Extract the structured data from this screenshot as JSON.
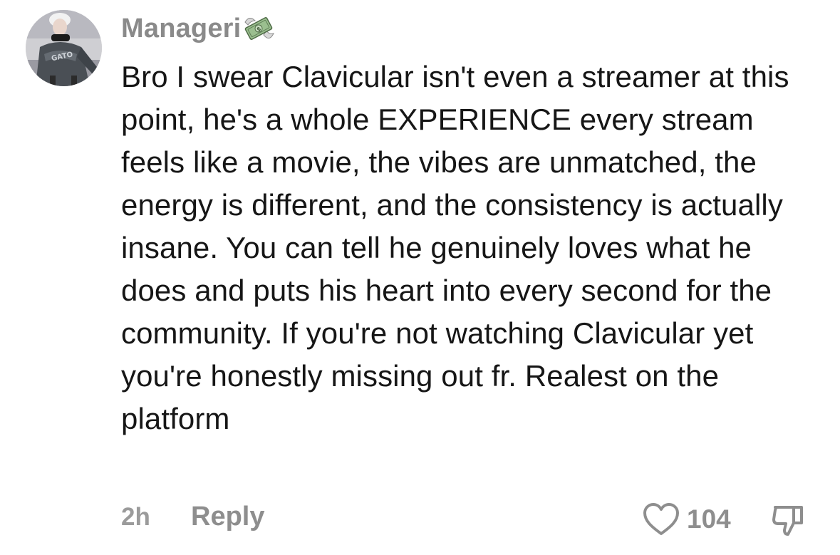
{
  "comment": {
    "username": "Manageri",
    "badge_icon": "money-with-wings-icon",
    "text": "Bro I swear Clavicular isn't even a streamer at this point, he's a whole EXPERIENCE every stream feels like a movie, the vibes are unmatched, the energy is different, and the consistency is actually insane. You can tell he genuinely loves what he does and puts his heart into every second for the community. If you're not watching Clavicular yet you're honestly missing out fr. Realest on the platform",
    "time_ago": "2h",
    "reply_label": "Reply",
    "like_count": "104",
    "avatar_shirt_text": "GATO"
  },
  "colors": {
    "text": "#161616",
    "muted": "#8e8e8e",
    "background": "#ffffff"
  }
}
